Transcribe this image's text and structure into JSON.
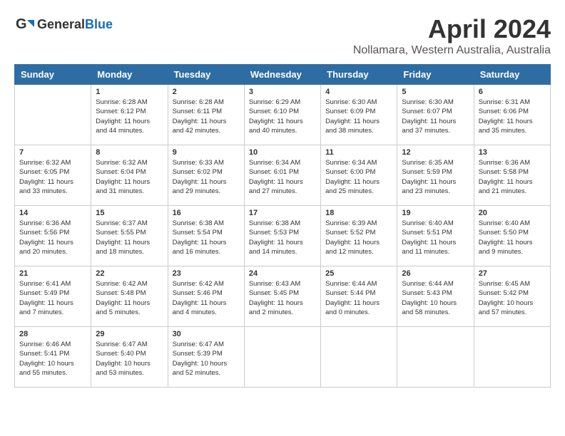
{
  "header": {
    "logo_general": "General",
    "logo_blue": "Blue",
    "month": "April 2024",
    "location": "Nollamara, Western Australia, Australia"
  },
  "weekdays": [
    "Sunday",
    "Monday",
    "Tuesday",
    "Wednesday",
    "Thursday",
    "Friday",
    "Saturday"
  ],
  "weeks": [
    [
      {
        "day": "",
        "info": ""
      },
      {
        "day": "1",
        "info": "Sunrise: 6:28 AM\nSunset: 6:12 PM\nDaylight: 11 hours\nand 44 minutes."
      },
      {
        "day": "2",
        "info": "Sunrise: 6:28 AM\nSunset: 6:11 PM\nDaylight: 11 hours\nand 42 minutes."
      },
      {
        "day": "3",
        "info": "Sunrise: 6:29 AM\nSunset: 6:10 PM\nDaylight: 11 hours\nand 40 minutes."
      },
      {
        "day": "4",
        "info": "Sunrise: 6:30 AM\nSunset: 6:09 PM\nDaylight: 11 hours\nand 38 minutes."
      },
      {
        "day": "5",
        "info": "Sunrise: 6:30 AM\nSunset: 6:07 PM\nDaylight: 11 hours\nand 37 minutes."
      },
      {
        "day": "6",
        "info": "Sunrise: 6:31 AM\nSunset: 6:06 PM\nDaylight: 11 hours\nand 35 minutes."
      }
    ],
    [
      {
        "day": "7",
        "info": "Sunrise: 6:32 AM\nSunset: 6:05 PM\nDaylight: 11 hours\nand 33 minutes."
      },
      {
        "day": "8",
        "info": "Sunrise: 6:32 AM\nSunset: 6:04 PM\nDaylight: 11 hours\nand 31 minutes."
      },
      {
        "day": "9",
        "info": "Sunrise: 6:33 AM\nSunset: 6:02 PM\nDaylight: 11 hours\nand 29 minutes."
      },
      {
        "day": "10",
        "info": "Sunrise: 6:34 AM\nSunset: 6:01 PM\nDaylight: 11 hours\nand 27 minutes."
      },
      {
        "day": "11",
        "info": "Sunrise: 6:34 AM\nSunset: 6:00 PM\nDaylight: 11 hours\nand 25 minutes."
      },
      {
        "day": "12",
        "info": "Sunrise: 6:35 AM\nSunset: 5:59 PM\nDaylight: 11 hours\nand 23 minutes."
      },
      {
        "day": "13",
        "info": "Sunrise: 6:36 AM\nSunset: 5:58 PM\nDaylight: 11 hours\nand 21 minutes."
      }
    ],
    [
      {
        "day": "14",
        "info": "Sunrise: 6:36 AM\nSunset: 5:56 PM\nDaylight: 11 hours\nand 20 minutes."
      },
      {
        "day": "15",
        "info": "Sunrise: 6:37 AM\nSunset: 5:55 PM\nDaylight: 11 hours\nand 18 minutes."
      },
      {
        "day": "16",
        "info": "Sunrise: 6:38 AM\nSunset: 5:54 PM\nDaylight: 11 hours\nand 16 minutes."
      },
      {
        "day": "17",
        "info": "Sunrise: 6:38 AM\nSunset: 5:53 PM\nDaylight: 11 hours\nand 14 minutes."
      },
      {
        "day": "18",
        "info": "Sunrise: 6:39 AM\nSunset: 5:52 PM\nDaylight: 11 hours\nand 12 minutes."
      },
      {
        "day": "19",
        "info": "Sunrise: 6:40 AM\nSunset: 5:51 PM\nDaylight: 11 hours\nand 11 minutes."
      },
      {
        "day": "20",
        "info": "Sunrise: 6:40 AM\nSunset: 5:50 PM\nDaylight: 11 hours\nand 9 minutes."
      }
    ],
    [
      {
        "day": "21",
        "info": "Sunrise: 6:41 AM\nSunset: 5:49 PM\nDaylight: 11 hours\nand 7 minutes."
      },
      {
        "day": "22",
        "info": "Sunrise: 6:42 AM\nSunset: 5:48 PM\nDaylight: 11 hours\nand 5 minutes."
      },
      {
        "day": "23",
        "info": "Sunrise: 6:42 AM\nSunset: 5:46 PM\nDaylight: 11 hours\nand 4 minutes."
      },
      {
        "day": "24",
        "info": "Sunrise: 6:43 AM\nSunset: 5:45 PM\nDaylight: 11 hours\nand 2 minutes."
      },
      {
        "day": "25",
        "info": "Sunrise: 6:44 AM\nSunset: 5:44 PM\nDaylight: 11 hours\nand 0 minutes."
      },
      {
        "day": "26",
        "info": "Sunrise: 6:44 AM\nSunset: 5:43 PM\nDaylight: 10 hours\nand 58 minutes."
      },
      {
        "day": "27",
        "info": "Sunrise: 6:45 AM\nSunset: 5:42 PM\nDaylight: 10 hours\nand 57 minutes."
      }
    ],
    [
      {
        "day": "28",
        "info": "Sunrise: 6:46 AM\nSunset: 5:41 PM\nDaylight: 10 hours\nand 55 minutes."
      },
      {
        "day": "29",
        "info": "Sunrise: 6:47 AM\nSunset: 5:40 PM\nDaylight: 10 hours\nand 53 minutes."
      },
      {
        "day": "30",
        "info": "Sunrise: 6:47 AM\nSunset: 5:39 PM\nDaylight: 10 hours\nand 52 minutes."
      },
      {
        "day": "",
        "info": ""
      },
      {
        "day": "",
        "info": ""
      },
      {
        "day": "",
        "info": ""
      },
      {
        "day": "",
        "info": ""
      }
    ]
  ]
}
